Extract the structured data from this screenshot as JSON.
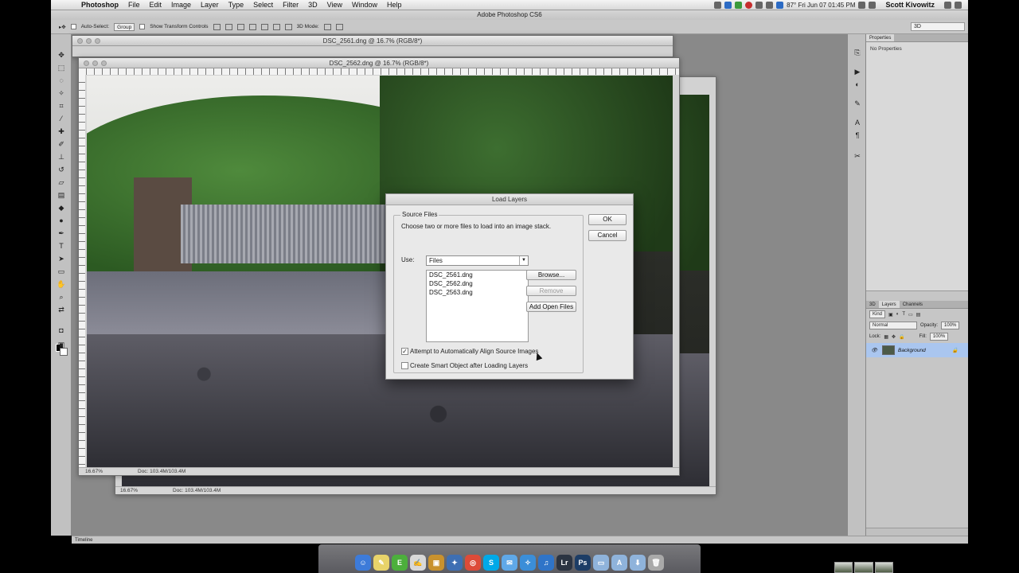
{
  "menubar": {
    "app": "Photoshop",
    "items": [
      "File",
      "Edit",
      "Image",
      "Layer",
      "Type",
      "Select",
      "Filter",
      "3D",
      "View",
      "Window",
      "Help"
    ],
    "status": "87° Fri Jun 07 01:45 PM",
    "user": "Scott Kivowitz"
  },
  "app_title": "Adobe Photoshop CS6",
  "tool_options": {
    "auto_select": "Auto-Select:",
    "group": "Group",
    "transform": "Show Transform Controls",
    "mode": "3D Mode:",
    "workspace": "3D"
  },
  "documents": [
    {
      "title": "DSC_2561.dng @ 16.7% (RGB/8*)"
    },
    {
      "title": "DSC_2562.dng @ 16.7% (RGB/8*)",
      "zoom": "16.67%",
      "doc": "Doc: 103.4M/103.4M"
    },
    {
      "zoom": "16.67%",
      "doc": "Doc: 103.4M/103.4M"
    }
  ],
  "panels": {
    "properties_tab": "Properties",
    "properties_body": "No Properties",
    "layers_tabs": [
      "3D",
      "Layers",
      "Channels"
    ],
    "kind": "Kind",
    "blend": "Normal",
    "opacity_label": "Opacity:",
    "opacity": "100%",
    "lock_label": "Lock:",
    "fill_label": "Fill:",
    "fill": "100%",
    "layer_name": "Background"
  },
  "timeline": "Timeline",
  "dialog": {
    "title": "Load Layers",
    "group": "Source Files",
    "instructions": "Choose two or more files to load into an image stack.",
    "use_label": "Use:",
    "use_value": "Files",
    "files": [
      "DSC_2561.dng",
      "DSC_2562.dng",
      "DSC_2563.dng"
    ],
    "buttons": {
      "ok": "OK",
      "cancel": "Cancel",
      "browse": "Browse...",
      "remove": "Remove",
      "add_open": "Add Open Files"
    },
    "align_label": "Attempt to Automatically Align Source Images",
    "align_checked": true,
    "smart_label": "Create Smart Object after Loading Layers",
    "smart_checked": false
  },
  "dock": {
    "apps": [
      {
        "icon": "finder-icon",
        "color": "#3d7bd9",
        "glyph": "☺"
      },
      {
        "icon": "notes-icon",
        "color": "#e8d36a",
        "glyph": "✎"
      },
      {
        "icon": "evernote-icon",
        "color": "#4caf3c",
        "glyph": "E"
      },
      {
        "icon": "textedit-icon",
        "color": "#d8d8d8",
        "glyph": "✍"
      },
      {
        "icon": "package-icon",
        "color": "#c9922e",
        "glyph": "▣"
      },
      {
        "icon": "bird-icon",
        "color": "#3e6fb3",
        "glyph": "✦"
      },
      {
        "icon": "chrome-icon",
        "color": "#dd4b39",
        "glyph": "◎"
      },
      {
        "icon": "skype-icon",
        "color": "#00a9e8",
        "glyph": "S"
      },
      {
        "icon": "messages-icon",
        "color": "#5fa8e8",
        "glyph": "✉"
      },
      {
        "icon": "safari-icon",
        "color": "#3b8ed8",
        "glyph": "✧"
      },
      {
        "icon": "itunes-icon",
        "color": "#2f74c8",
        "glyph": "♫"
      },
      {
        "icon": "lightroom-icon",
        "color": "#2b3442",
        "glyph": "Lr"
      },
      {
        "icon": "photoshop-icon",
        "color": "#1d3d66",
        "glyph": "Ps"
      },
      {
        "icon": "folder-icon",
        "color": "#8fb3db",
        "glyph": "▭"
      },
      {
        "icon": "apps-folder-icon",
        "color": "#8fb3db",
        "glyph": "A"
      },
      {
        "icon": "downloads-icon",
        "color": "#8fb3db",
        "glyph": "⬇"
      },
      {
        "icon": "trash-icon",
        "color": "#a9a9a9",
        "glyph": "🗑"
      }
    ]
  }
}
